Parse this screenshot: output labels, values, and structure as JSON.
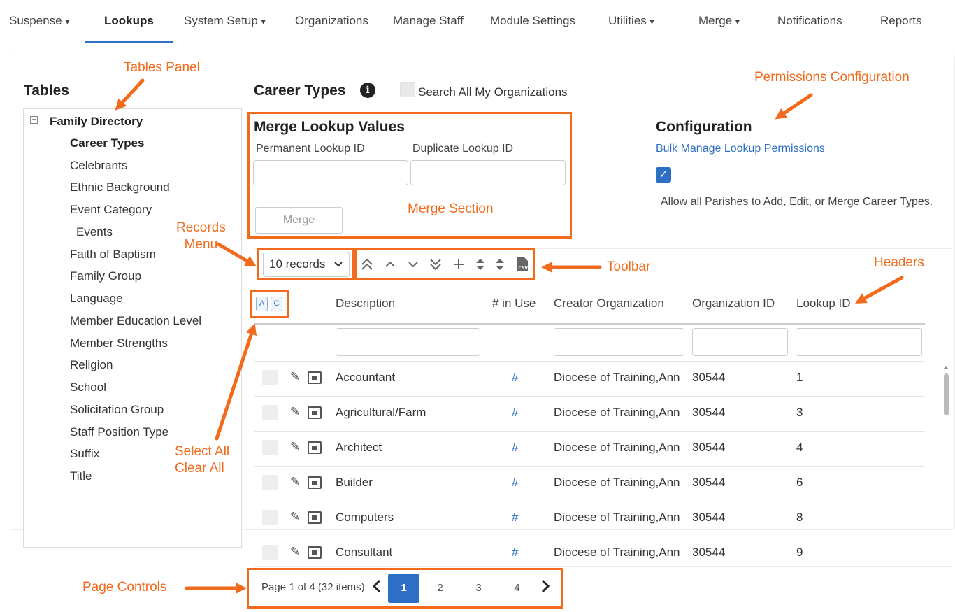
{
  "nav": {
    "items": [
      {
        "label": "Suspense",
        "caret": "▾"
      },
      {
        "label": "Lookups"
      },
      {
        "label": "System Setup",
        "caret": "▾"
      },
      {
        "label": "Organizations"
      },
      {
        "label": "Manage Staff"
      },
      {
        "label": "Module Settings"
      },
      {
        "label": "Utilities",
        "caret": "▾"
      },
      {
        "label": "Merge",
        "caret": "▾"
      },
      {
        "label": "Notifications"
      },
      {
        "label": "Reports"
      }
    ],
    "active": "Lookups"
  },
  "tables": {
    "heading": "Tables",
    "root": "Family Directory",
    "toggle": "−",
    "items": [
      "Career Types",
      "Celebrants",
      "Ethnic Background",
      "Event Category",
      "Events",
      "Faith of Baptism",
      "Family Group",
      "Language",
      "Member Education Level",
      "Member Strengths",
      "Religion",
      "School",
      "Solicitation Group",
      "Staff Position Type",
      "Suffix",
      "Title"
    ],
    "selected": "Career Types"
  },
  "header": {
    "title": "Career Types",
    "info_icon": "info-icon",
    "search_all_label": "Search All My Organizations"
  },
  "merge": {
    "heading": "Merge Lookup Values",
    "permanent_label": "Permanent Lookup ID",
    "duplicate_label": "Duplicate Lookup ID",
    "permanent_value": "",
    "duplicate_value": "",
    "button": "Merge"
  },
  "config": {
    "heading": "Configuration",
    "link": "Bulk Manage Lookup Permissions",
    "checked": true,
    "permission_text": "Allow all Parishes to Add, Edit, or Merge Career Types."
  },
  "toolbar": {
    "records": "10 records",
    "icons": [
      "move-top-icon",
      "move-up-icon",
      "move-down-icon",
      "move-bottom-icon",
      "add-icon",
      "sort-icon",
      "sort-alt-icon",
      "csv-export-icon"
    ]
  },
  "grid": {
    "select_all": "A",
    "clear_all": "C",
    "columns": [
      "Description",
      "# in Use",
      "Creator Organization",
      "Organization ID",
      "Lookup ID"
    ],
    "rows": [
      {
        "description": "Accountant",
        "in_use": "#",
        "creator": "Diocese of Training,Ann",
        "org_id": "30544",
        "lookup_id": "1"
      },
      {
        "description": "Agricultural/Farm",
        "in_use": "#",
        "creator": "Diocese of Training,Ann",
        "org_id": "30544",
        "lookup_id": "3"
      },
      {
        "description": "Architect",
        "in_use": "#",
        "creator": "Diocese of Training,Ann",
        "org_id": "30544",
        "lookup_id": "4"
      },
      {
        "description": "Builder",
        "in_use": "#",
        "creator": "Diocese of Training,Ann",
        "org_id": "30544",
        "lookup_id": "6"
      },
      {
        "description": "Computers",
        "in_use": "#",
        "creator": "Diocese of Training,Ann",
        "org_id": "30544",
        "lookup_id": "8"
      },
      {
        "description": "Consultant",
        "in_use": "#",
        "creator": "Diocese of Training,Ann",
        "org_id": "30544",
        "lookup_id": "9"
      }
    ]
  },
  "pager": {
    "summary": "Page 1 of 4 (32 items)",
    "pages": [
      "1",
      "2",
      "3",
      "4"
    ],
    "current": "1"
  },
  "annotations": {
    "tables_panel": "Tables Panel",
    "permissions": "Permissions Configuration",
    "merge_section": "Merge Section",
    "records_menu": "Records\nMenu",
    "toolbar": "Toolbar",
    "headers": "Headers",
    "select_clear": "Select All\nClear All",
    "page_controls": "Page Controls",
    "color": "#f26a1b"
  }
}
